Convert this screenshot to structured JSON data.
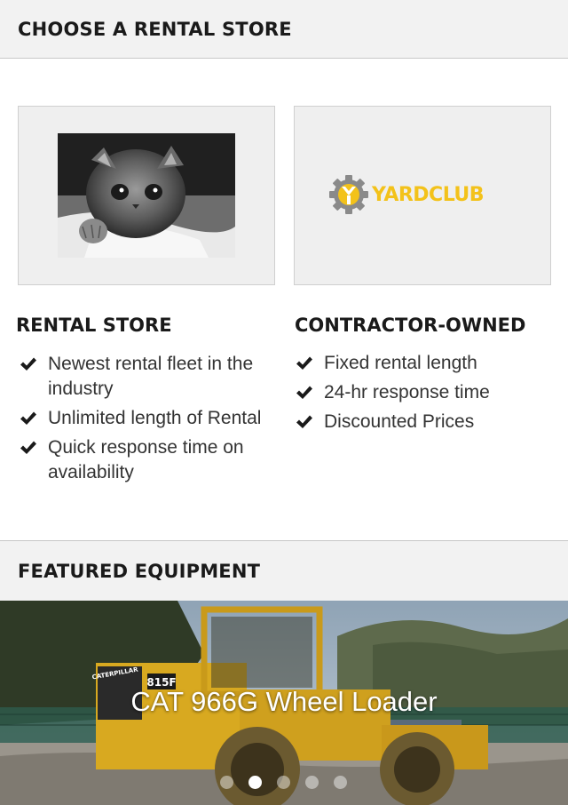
{
  "stores_section": {
    "title": "CHOOSE A RENTAL STORE"
  },
  "stores": [
    {
      "title": "RENTAL STORE",
      "image": "kitten-photo",
      "features": [
        "Newest rental fleet in the industry",
        "Unlimited length of Rental",
        "Quick response time on availability"
      ]
    },
    {
      "title": "CONTRACTOR-OWNED",
      "image": "yardclub-logo",
      "logo_text": "YARDCLUB",
      "features": [
        "Fixed rental length",
        "24-hr response time",
        "Discounted Prices"
      ]
    }
  ],
  "featured_section": {
    "title": "FEATURED EQUIPMENT"
  },
  "carousel": {
    "caption": "CAT 966G Wheel Loader",
    "machine_label": "815F",
    "brand_label": "CATERPILLAR",
    "slide_count": 5,
    "active_index": 1
  },
  "colors": {
    "header_bg": "#f2f2f2",
    "card_bg": "#efefef",
    "logo_yellow": "#f3c21a",
    "logo_gear": "#8a8a8a",
    "text": "#1a1a1a"
  },
  "icons": {
    "feature_bullet": "checkmark-icon",
    "logo_mark": "gear-icon"
  }
}
